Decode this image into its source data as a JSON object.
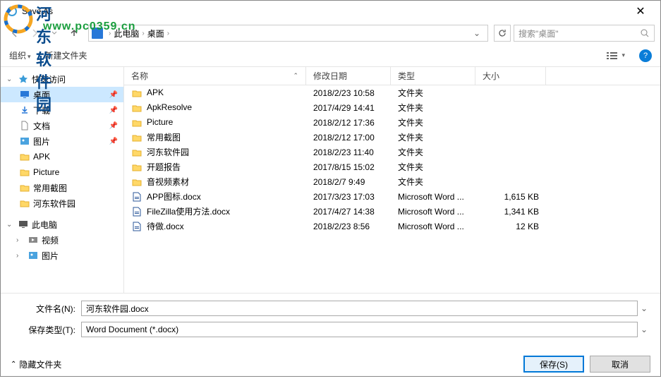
{
  "window": {
    "title": "Save As"
  },
  "watermark": {
    "text": "河东软件园",
    "url": "www.pc0359.cn"
  },
  "breadcrumb": {
    "parts": [
      "此电脑",
      "桌面"
    ],
    "dropdown": "›"
  },
  "search": {
    "placeholder": "搜索\"桌面\""
  },
  "toolbar": {
    "organize": "组织",
    "new_folder": "新建文件夹"
  },
  "tree": {
    "quick_access": "快速访问",
    "desktop": "桌面",
    "downloads": "下载",
    "documents": "文档",
    "pictures": "图片",
    "apk": "APK",
    "picture": "Picture",
    "common_shot": "常用截图",
    "hedong": "河东软件园",
    "this_pc": "此电脑",
    "videos": "视频",
    "pictures2": "图片"
  },
  "columns": {
    "name": "名称",
    "date": "修改日期",
    "type": "类型",
    "size": "大小"
  },
  "files": [
    {
      "name": "APK",
      "date": "2018/2/23 10:58",
      "type": "文件夹",
      "size": "",
      "kind": "folder"
    },
    {
      "name": "ApkResolve",
      "date": "2017/4/29 14:41",
      "type": "文件夹",
      "size": "",
      "kind": "folder"
    },
    {
      "name": "Picture",
      "date": "2018/2/12 17:36",
      "type": "文件夹",
      "size": "",
      "kind": "folder"
    },
    {
      "name": "常用截图",
      "date": "2018/2/12 17:00",
      "type": "文件夹",
      "size": "",
      "kind": "folder"
    },
    {
      "name": "河东软件园",
      "date": "2018/2/23 11:40",
      "type": "文件夹",
      "size": "",
      "kind": "folder"
    },
    {
      "name": "开题报告",
      "date": "2017/8/15 15:02",
      "type": "文件夹",
      "size": "",
      "kind": "folder"
    },
    {
      "name": "音视频素材",
      "date": "2018/2/7 9:49",
      "type": "文件夹",
      "size": "",
      "kind": "folder"
    },
    {
      "name": "APP图标.docx",
      "date": "2017/3/23 17:03",
      "type": "Microsoft Word ...",
      "size": "1,615 KB",
      "kind": "docx"
    },
    {
      "name": "FileZilla使用方法.docx",
      "date": "2017/4/27 14:38",
      "type": "Microsoft Word ...",
      "size": "1,341 KB",
      "kind": "docx"
    },
    {
      "name": "待做.docx",
      "date": "2018/2/23 8:56",
      "type": "Microsoft Word ...",
      "size": "12 KB",
      "kind": "docx"
    }
  ],
  "form": {
    "filename_label": "文件名(N):",
    "filename_value": "河东软件园.docx",
    "filetype_label": "保存类型(T):",
    "filetype_value": "Word Document (*.docx)"
  },
  "actions": {
    "hide_folders": "隐藏文件夹",
    "save": "保存(S)",
    "cancel": "取消"
  }
}
